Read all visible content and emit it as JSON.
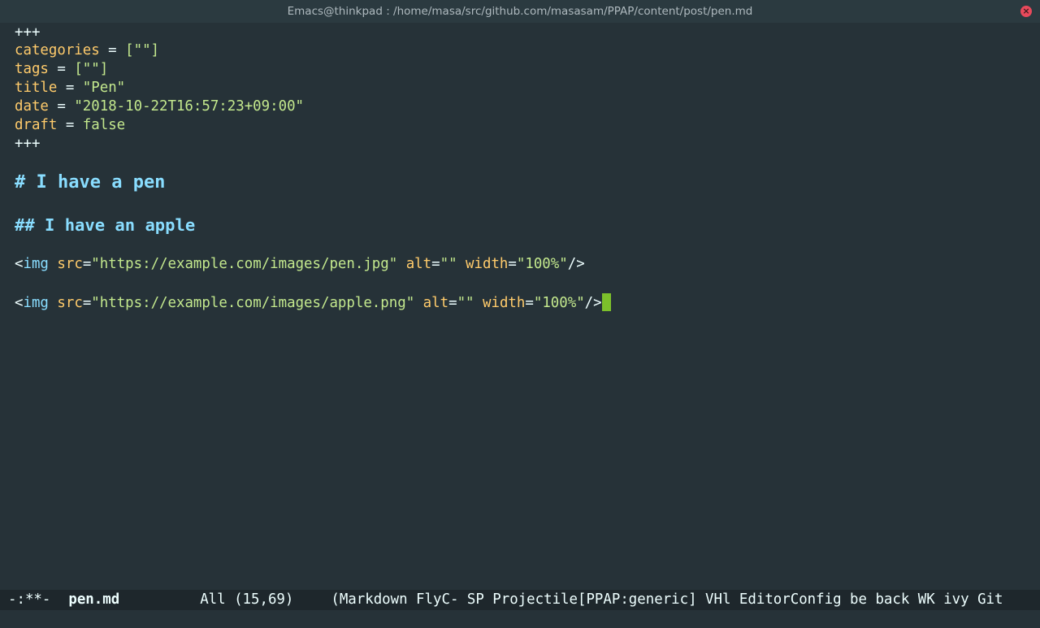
{
  "window": {
    "title": "Emacs@thinkpad : /home/masa/src/github.com/masasam/PPAP/content/post/pen.md",
    "close_glyph": "×"
  },
  "frontmatter": {
    "delimiter": "+++",
    "categories_key": "categories",
    "categories_value": "[\"\"]",
    "tags_key": "tags",
    "tags_value": "[\"\"]",
    "title_key": "title",
    "title_value": "\"Pen\"",
    "date_key": "date",
    "date_value": "\"2018-10-22T16:57:23+09:00\"",
    "draft_key": "draft",
    "draft_value": "false",
    "equals": " = "
  },
  "content": {
    "h1": "# I have a pen",
    "h2": "## I have an apple",
    "img1": {
      "open": "<",
      "tag": "img",
      "src_attr": "src",
      "src_val": "\"https://example.com/images/pen.jpg\"",
      "alt_attr": "alt",
      "alt_val": "\"\"",
      "width_attr": "width",
      "width_val": "\"100%\"",
      "close": "/>"
    },
    "img2": {
      "open": "<",
      "tag": "img",
      "src_attr": "src",
      "src_val": "\"https://example.com/images/apple.png\"",
      "alt_attr": "alt",
      "alt_val": "\"\"",
      "width_attr": "width",
      "width_val": "\"100%\"",
      "close": "/>"
    }
  },
  "modeline": {
    "status": "-:**-",
    "buffer": "pen.md",
    "position": "All (15,69)",
    "modes": "(Markdown FlyC- SP Projectile[PPAP:generic] VHl EditorConfig be back WK ivy Git"
  },
  "colors": {
    "background": "#263238",
    "key": "#ffcb6b",
    "string": "#c3e88d",
    "heading": "#89ddff",
    "cursor": "#7cc02b"
  }
}
